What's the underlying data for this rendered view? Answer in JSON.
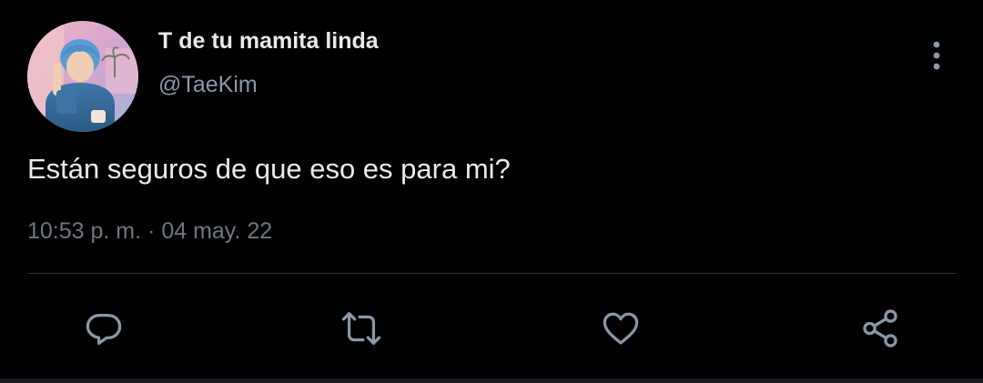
{
  "tweet": {
    "display_name": "T de tu mamita linda",
    "handle": "@TaeKim",
    "text": "Están seguros de que eso es para mi?",
    "time": "10:53 p. m.",
    "separator": "·",
    "date": "04 may. 22"
  },
  "icons": {
    "more": "more-vertical-icon",
    "reply": "reply-icon",
    "retweet": "retweet-icon",
    "like": "heart-icon",
    "share": "share-icon"
  },
  "colors": {
    "background": "#000000",
    "name_text": "#e7e9ea",
    "secondary_text": "#8b98a5",
    "icon": "#8b98a5",
    "divider": "#2f3336"
  }
}
